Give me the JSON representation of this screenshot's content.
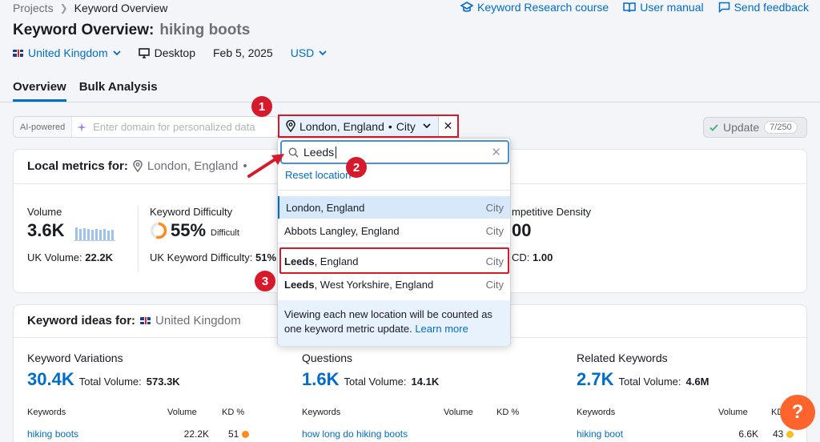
{
  "breadcrumb": {
    "root": "Projects",
    "current": "Keyword Overview"
  },
  "top_links": {
    "course": "Keyword Research course",
    "manual": "User manual",
    "feedback": "Send feedback"
  },
  "title": {
    "prefix": "Keyword Overview:",
    "keyword": "hiking boots"
  },
  "filters": {
    "country": "United Kingdom",
    "device": "Desktop",
    "date": "Feb 5, 2025",
    "currency": "USD"
  },
  "tabs": [
    "Overview",
    "Bulk Analysis"
  ],
  "ai_search": {
    "badge": "AI-powered",
    "placeholder": "Enter domain for personalized data"
  },
  "location_selector": {
    "label": "London, England",
    "type": "City"
  },
  "update": {
    "label": "Update",
    "count": "7/250"
  },
  "local_metrics": {
    "header": "Local metrics for:",
    "location": "London, England",
    "volume": {
      "label": "Volume",
      "value": "3.6K",
      "sub_label": "UK Volume:",
      "sub_value": "22.2K",
      "trend": [
        0.9,
        0.8,
        0.85,
        0.75,
        0.7,
        0.8,
        0.7,
        0.75,
        0.65,
        0.7
      ]
    },
    "kd": {
      "label": "Keyword Difficulty",
      "value": "55%",
      "level": "Difficult",
      "percent": 55,
      "sub_label": "UK Keyword Difficulty:",
      "sub_value": "51%"
    },
    "cd": {
      "label": "mpetitive Density",
      "value": "00",
      "sub_label": "CD:",
      "sub_value": "1.00"
    }
  },
  "dropdown": {
    "query": "Leeds",
    "reset": "Reset location",
    "options": [
      {
        "bold": "",
        "name": "London, England",
        "type": "City"
      },
      {
        "bold": "",
        "name": "Abbots Langley, England",
        "type": "City"
      },
      {
        "bold": "Leeds",
        "name": ", England",
        "type": "City"
      },
      {
        "bold": "Leeds",
        "name": ", West Yorkshire, England",
        "type": "City"
      }
    ],
    "note": "Viewing each new location will be counted as one keyword metric update.",
    "learn_more": "Learn more"
  },
  "keyword_ideas": {
    "header": "Keyword ideas for:",
    "country": "United Kingdom",
    "columns": [
      {
        "title": "Keyword Variations",
        "value": "30.4K",
        "total_label": "Total Volume:",
        "total": "573.3K",
        "h_kw": "Keywords",
        "h_vol": "Volume",
        "h_kd": "KD %",
        "kw": "hiking boots",
        "vol": "22.2K",
        "kd": "51",
        "kd_color": "#ff8c1a"
      },
      {
        "title": "Questions",
        "value": "1.6K",
        "total_label": "Total Volume:",
        "total": "14.1K",
        "h_kw": "Keywords",
        "h_vol": "Volume",
        "h_kd": "KD %",
        "kw": "how long do hiking boots",
        "vol": "",
        "kd": "",
        "kd_color": ""
      },
      {
        "title": "Related Keywords",
        "value": "2.7K",
        "total_label": "Total Volume:",
        "total": "4.6M",
        "h_kw": "Keywords",
        "h_vol": "Volume",
        "h_kd": "KD",
        "kw": "hiking boot",
        "vol": "6.6K",
        "kd": "43",
        "kd_color": "#f5c024"
      }
    ]
  },
  "callouts": [
    "1",
    "2",
    "3"
  ],
  "help": "?"
}
